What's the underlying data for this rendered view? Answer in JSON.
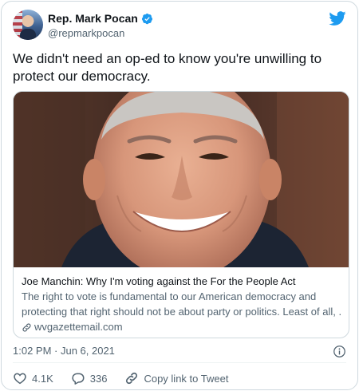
{
  "author": {
    "name": "Rep. Mark Pocan",
    "handle": "@repmarkpocan",
    "verified": true
  },
  "tweet": {
    "text": "We didn't need an op-ed to know you're unwilling to protect our democracy."
  },
  "link_card": {
    "title": "Joe Manchin: Why I'm voting against the For the People Act",
    "description_line1": "The right to vote is fundamental to our American democracy and",
    "description_line2": "protecting that right should not be about party or politics. Least of all, ...",
    "domain": "wvgazettemail.com"
  },
  "timestamp": "1:02 PM · Jun 6, 2021",
  "actions": {
    "likes": "4.1K",
    "replies": "336",
    "copy_link_label": "Copy link to Tweet"
  },
  "colors": {
    "twitter_blue": "#1d9bf0",
    "like_red": "#f91880",
    "secondary_text": "#536471"
  },
  "icons": [
    "verified-badge-icon",
    "twitter-bird-icon",
    "link-icon",
    "info-icon",
    "heart-icon",
    "reply-icon",
    "copy-link-icon"
  ]
}
